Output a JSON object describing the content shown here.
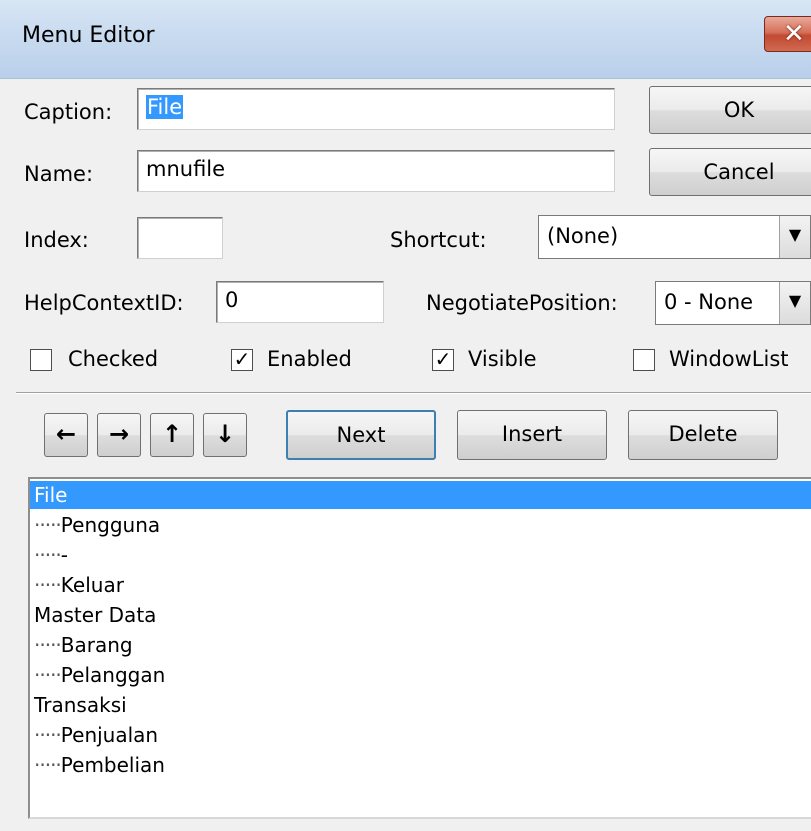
{
  "window": {
    "title": "Menu Editor",
    "close_glyph": "✕",
    "close_icon": "close-icon"
  },
  "form": {
    "caption_label": "Caption:",
    "caption_value": "File",
    "name_label": "Name:",
    "name_value": "mnufile",
    "index_label": "Index:",
    "index_value": "",
    "shortcut_label": "Shortcut:",
    "shortcut_value": "(None)",
    "helpcontext_label": "HelpContextID:",
    "helpcontext_value": "0",
    "negotiate_label": "NegotiatePosition:",
    "negotiate_value": "0 - None"
  },
  "checkboxes": {
    "checked": {
      "label": "Checked",
      "value": false
    },
    "enabled": {
      "label": "Enabled",
      "value": true
    },
    "visible": {
      "label": "Visible",
      "value": true
    },
    "windowlist": {
      "label": "WindowList",
      "value": false
    }
  },
  "buttons": {
    "ok": "OK",
    "cancel": "Cancel",
    "next": "Next",
    "insert": "Insert",
    "delete": "Delete"
  },
  "arrows": {
    "left": "←",
    "right": "→",
    "up": "↑",
    "down": "↓"
  },
  "menu_items": [
    {
      "level": 0,
      "label": "File",
      "selected": true
    },
    {
      "level": 1,
      "label": "Pengguna",
      "selected": false
    },
    {
      "level": 1,
      "label": "-",
      "selected": false
    },
    {
      "level": 1,
      "label": "Keluar",
      "selected": false
    },
    {
      "level": 0,
      "label": "Master Data",
      "selected": false
    },
    {
      "level": 1,
      "label": "Barang",
      "selected": false
    },
    {
      "level": 1,
      "label": "Pelanggan",
      "selected": false
    },
    {
      "level": 0,
      "label": "Transaksi",
      "selected": false
    },
    {
      "level": 1,
      "label": "Penjualan",
      "selected": false
    },
    {
      "level": 1,
      "label": "Pembelian",
      "selected": false
    }
  ],
  "indent_marker": "·····",
  "colors": {
    "selection": "#3399ff",
    "close_button": "#c34a32"
  }
}
